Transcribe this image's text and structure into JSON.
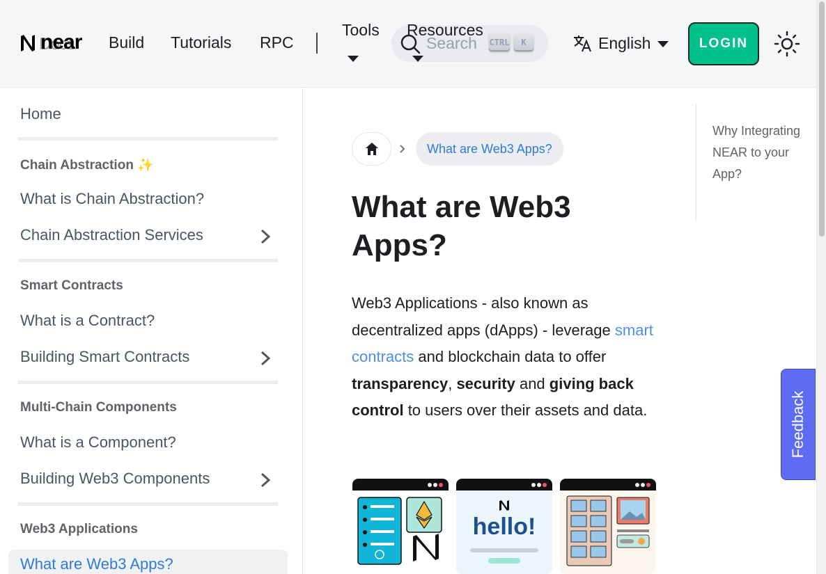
{
  "navbar": {
    "logo_text": "near",
    "logo_ghost_text": "Docs",
    "links": {
      "build": "Build",
      "tutorials": "Tutorials",
      "rpc": "RPC"
    },
    "dropdowns": {
      "tools": "Tools",
      "resources": "Resources"
    },
    "search": {
      "placeholder": "Search",
      "key_ctrl": "CTRL",
      "key_k": "K"
    },
    "language": "English",
    "login": "LOGIN",
    "icons": {
      "search": "search-icon",
      "language": "translate-icon",
      "theme": "sun-icon",
      "logo": "near-logo-icon"
    }
  },
  "sidebar": {
    "home": "Home",
    "sections": [
      {
        "title": "Chain Abstraction ✨",
        "items": [
          "What is Chain Abstraction?",
          "Chain Abstraction Services"
        ]
      },
      {
        "title": "Smart Contracts",
        "items": [
          "What is a Contract?",
          "Building Smart Contracts"
        ]
      },
      {
        "title": "Multi-Chain Components",
        "items": [
          "What is a Component?",
          "Building Web3 Components"
        ]
      },
      {
        "title": "Web3 Applications",
        "items": [
          "What are Web3 Apps?"
        ]
      }
    ],
    "active_item": "What are Web3 Apps?"
  },
  "breadcrumb": {
    "current": "What are Web3 Apps?"
  },
  "article": {
    "title": "What are Web3 Apps?",
    "intro_1": "Web3 Applications - also known as decentralized apps (dApps) - leverage",
    "intro_link": "smart contracts",
    "intro_2": "and blockchain data to offer",
    "bold_1": "transparency",
    "sep_1": ",",
    "bold_2": "security",
    "and_word": "and",
    "bold_3": "giving back control",
    "intro_3": "to users over their assets and data.",
    "illustration_text": "hello!"
  },
  "toc": {
    "items": [
      "Why Integrating NEAR to your App?"
    ]
  },
  "feedback": "Feedback",
  "colors": {
    "accent": "#00c08b",
    "link": "#2f7bd8",
    "feedback": "#5e6bf2"
  }
}
